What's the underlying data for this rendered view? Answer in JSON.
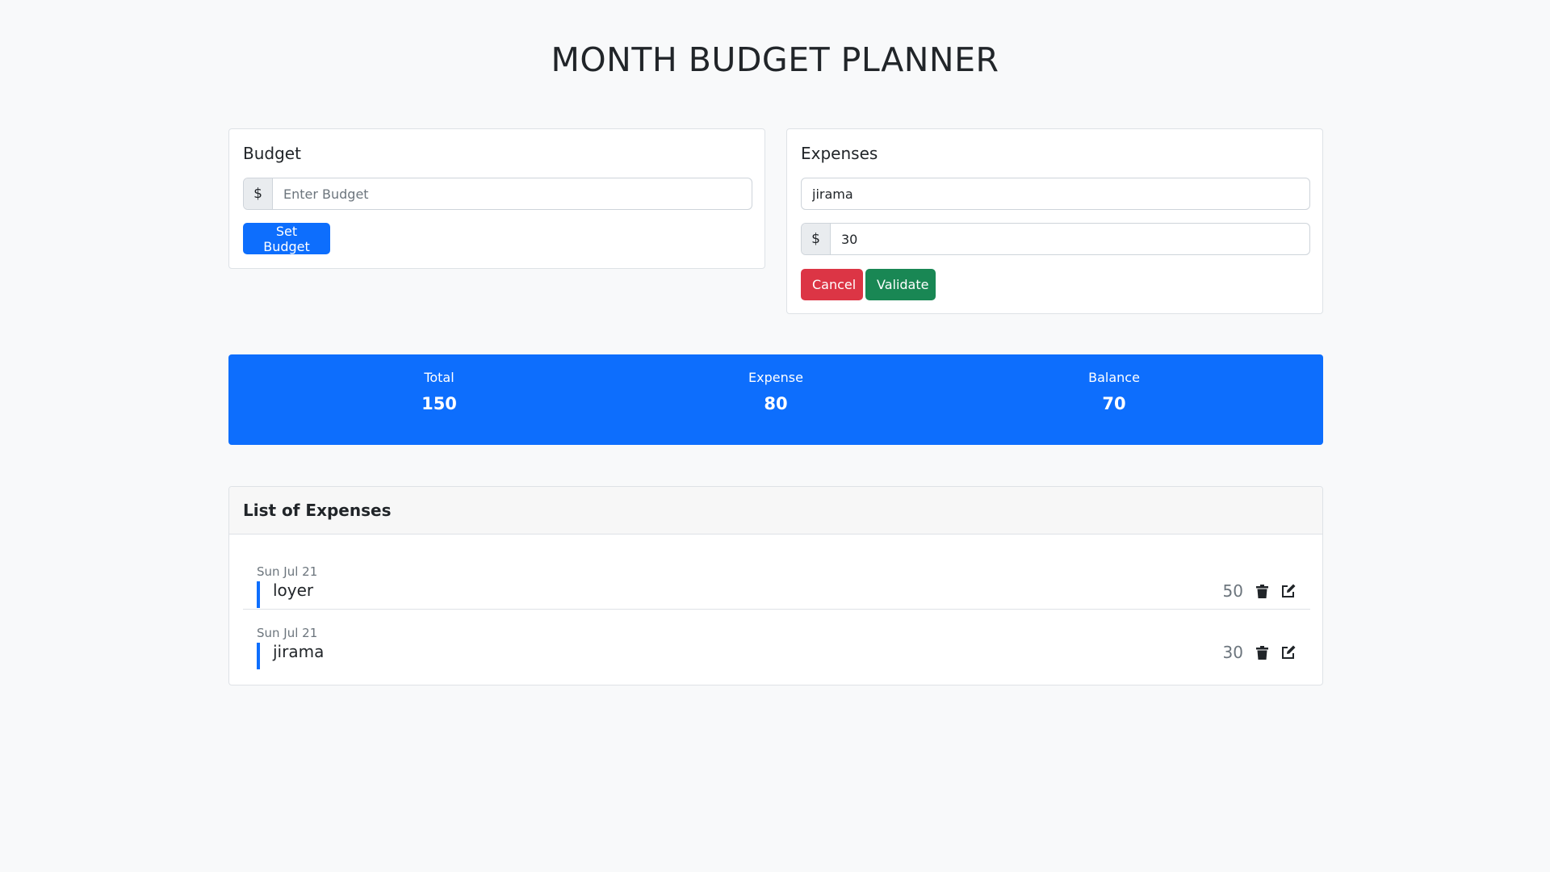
{
  "header": {
    "title": "MONTH BUDGET PLANNER"
  },
  "budget": {
    "title": "Budget",
    "currency": "$",
    "placeholder": "Enter Budget",
    "value": "",
    "set_label": "Set Budget"
  },
  "expenses_form": {
    "title": "Expenses",
    "name_value": "jirama",
    "currency": "$",
    "amount_value": "30",
    "cancel_label": "Cancel",
    "validate_label": "Validate"
  },
  "stats": {
    "total_label": "Total",
    "total_value": "150",
    "expense_label": "Expense",
    "expense_value": "80",
    "balance_label": "Balance",
    "balance_value": "70"
  },
  "list": {
    "title": "List of Expenses",
    "items": [
      {
        "date": "Sun Jul 21",
        "name": "loyer",
        "amount": "50"
      },
      {
        "date": "Sun Jul 21",
        "name": "jirama",
        "amount": "30"
      }
    ]
  },
  "icons": {
    "delete": "trash-icon",
    "edit": "edit-icon"
  },
  "colors": {
    "primary": "#0d6efd",
    "danger": "#dc3545",
    "success": "#198754"
  }
}
